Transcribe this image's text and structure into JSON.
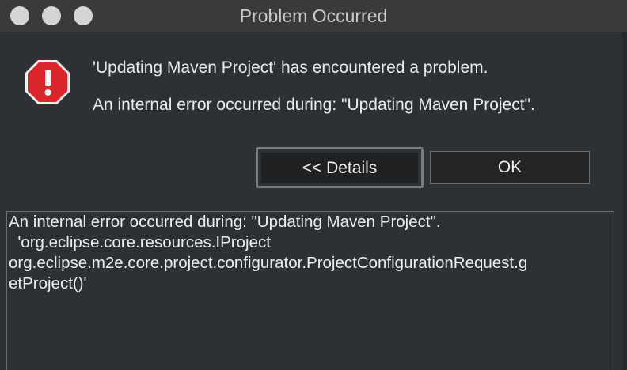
{
  "window": {
    "title": "Problem Occurred"
  },
  "message": {
    "line1": "'Updating Maven Project' has encountered a problem.",
    "line2": "An internal error occurred during: \"Updating Maven Project\"."
  },
  "buttons": {
    "details_label": "<< Details",
    "ok_label": "OK"
  },
  "details": {
    "lines": [
      "An internal error occurred during: \"Updating Maven Project\".",
      "  'org.eclipse.core.resources.IProject",
      "org.eclipse.m2e.core.project.configurator.ProjectConfigurationRequest.g",
      "etProject()'"
    ]
  },
  "colors": {
    "error_icon": "#d9262b",
    "background": "#2d3135",
    "titlebar": "#3a3a3c"
  },
  "icons": {
    "error": "error-octagon-icon"
  }
}
